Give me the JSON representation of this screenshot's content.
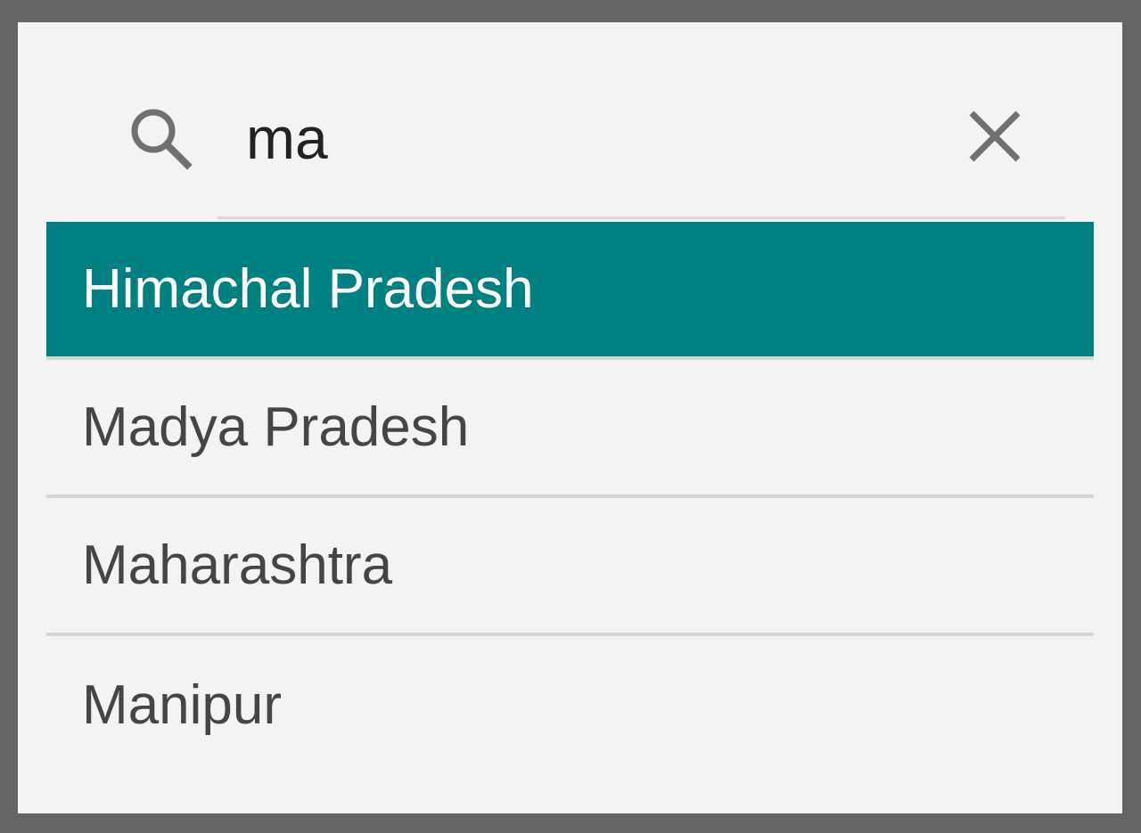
{
  "colors": {
    "backdrop": "#656565",
    "panel": "#f3f3f3",
    "selected_background": "#008080",
    "selected_text": "#ffffff",
    "item_text": "#454545",
    "icon": "#707070",
    "divider": "#d6d6d6"
  },
  "search": {
    "value": "ma",
    "search_icon": "search-icon",
    "clear_icon": "close-icon"
  },
  "results": {
    "items": [
      {
        "label": "Himachal Pradesh",
        "selected": true
      },
      {
        "label": "Madya Pradesh",
        "selected": false
      },
      {
        "label": "Maharashtra",
        "selected": false
      },
      {
        "label": "Manipur",
        "selected": false
      }
    ]
  }
}
